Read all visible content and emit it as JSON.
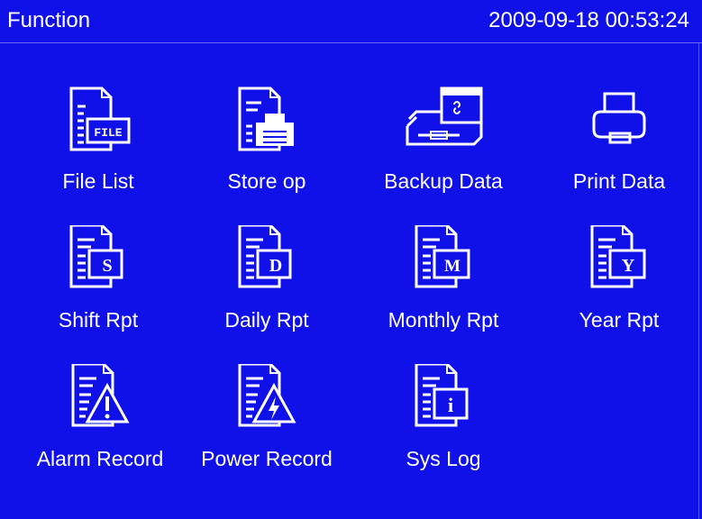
{
  "header": {
    "title": "Function",
    "datetime": "2009-09-18 00:53:24"
  },
  "menu": [
    {
      "label": "File List",
      "icon": "file-list-icon"
    },
    {
      "label": "Store op",
      "icon": "store-op-icon"
    },
    {
      "label": "Backup Data",
      "icon": "backup-data-icon"
    },
    {
      "label": "Print Data",
      "icon": "printer-icon"
    },
    {
      "label": "Shift Rpt",
      "icon": "shift-report-icon"
    },
    {
      "label": "Daily Rpt",
      "icon": "daily-report-icon"
    },
    {
      "label": "Monthly Rpt",
      "icon": "monthly-report-icon"
    },
    {
      "label": "Year Rpt",
      "icon": "year-report-icon"
    },
    {
      "label": "Alarm Record",
      "icon": "alarm-record-icon"
    },
    {
      "label": "Power Record",
      "icon": "power-record-icon"
    },
    {
      "label": "Sys Log",
      "icon": "system-log-icon"
    }
  ],
  "icon_badges": {
    "file": "FILE",
    "shift": "S",
    "daily": "D",
    "monthly": "M",
    "year": "Y",
    "syslog": "i"
  },
  "colors": {
    "background": "#1010e8",
    "foreground": "#ffffff"
  }
}
